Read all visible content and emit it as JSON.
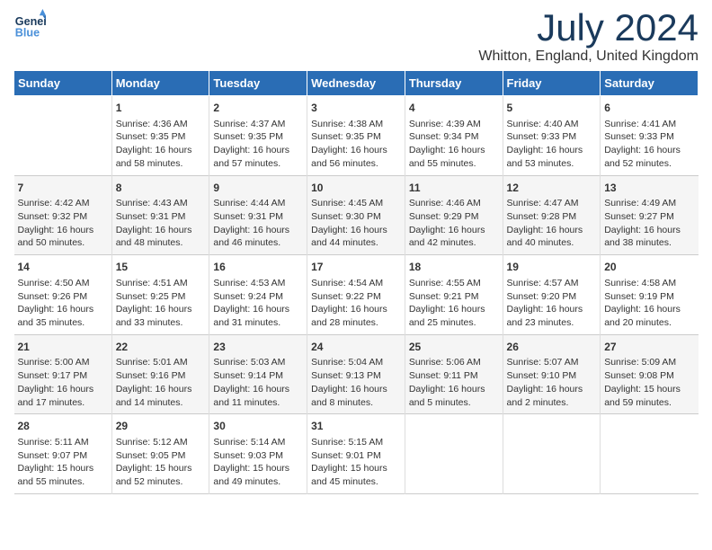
{
  "header": {
    "logo_line1": "General",
    "logo_line2": "Blue",
    "title": "July 2024",
    "subtitle": "Whitton, England, United Kingdom"
  },
  "days_of_week": [
    "Sunday",
    "Monday",
    "Tuesday",
    "Wednesday",
    "Thursday",
    "Friday",
    "Saturday"
  ],
  "weeks": [
    [
      {
        "day": "",
        "info": ""
      },
      {
        "day": "1",
        "info": "Sunrise: 4:36 AM\nSunset: 9:35 PM\nDaylight: 16 hours\nand 58 minutes."
      },
      {
        "day": "2",
        "info": "Sunrise: 4:37 AM\nSunset: 9:35 PM\nDaylight: 16 hours\nand 57 minutes."
      },
      {
        "day": "3",
        "info": "Sunrise: 4:38 AM\nSunset: 9:35 PM\nDaylight: 16 hours\nand 56 minutes."
      },
      {
        "day": "4",
        "info": "Sunrise: 4:39 AM\nSunset: 9:34 PM\nDaylight: 16 hours\nand 55 minutes."
      },
      {
        "day": "5",
        "info": "Sunrise: 4:40 AM\nSunset: 9:33 PM\nDaylight: 16 hours\nand 53 minutes."
      },
      {
        "day": "6",
        "info": "Sunrise: 4:41 AM\nSunset: 9:33 PM\nDaylight: 16 hours\nand 52 minutes."
      }
    ],
    [
      {
        "day": "7",
        "info": "Sunrise: 4:42 AM\nSunset: 9:32 PM\nDaylight: 16 hours\nand 50 minutes."
      },
      {
        "day": "8",
        "info": "Sunrise: 4:43 AM\nSunset: 9:31 PM\nDaylight: 16 hours\nand 48 minutes."
      },
      {
        "day": "9",
        "info": "Sunrise: 4:44 AM\nSunset: 9:31 PM\nDaylight: 16 hours\nand 46 minutes."
      },
      {
        "day": "10",
        "info": "Sunrise: 4:45 AM\nSunset: 9:30 PM\nDaylight: 16 hours\nand 44 minutes."
      },
      {
        "day": "11",
        "info": "Sunrise: 4:46 AM\nSunset: 9:29 PM\nDaylight: 16 hours\nand 42 minutes."
      },
      {
        "day": "12",
        "info": "Sunrise: 4:47 AM\nSunset: 9:28 PM\nDaylight: 16 hours\nand 40 minutes."
      },
      {
        "day": "13",
        "info": "Sunrise: 4:49 AM\nSunset: 9:27 PM\nDaylight: 16 hours\nand 38 minutes."
      }
    ],
    [
      {
        "day": "14",
        "info": "Sunrise: 4:50 AM\nSunset: 9:26 PM\nDaylight: 16 hours\nand 35 minutes."
      },
      {
        "day": "15",
        "info": "Sunrise: 4:51 AM\nSunset: 9:25 PM\nDaylight: 16 hours\nand 33 minutes."
      },
      {
        "day": "16",
        "info": "Sunrise: 4:53 AM\nSunset: 9:24 PM\nDaylight: 16 hours\nand 31 minutes."
      },
      {
        "day": "17",
        "info": "Sunrise: 4:54 AM\nSunset: 9:22 PM\nDaylight: 16 hours\nand 28 minutes."
      },
      {
        "day": "18",
        "info": "Sunrise: 4:55 AM\nSunset: 9:21 PM\nDaylight: 16 hours\nand 25 minutes."
      },
      {
        "day": "19",
        "info": "Sunrise: 4:57 AM\nSunset: 9:20 PM\nDaylight: 16 hours\nand 23 minutes."
      },
      {
        "day": "20",
        "info": "Sunrise: 4:58 AM\nSunset: 9:19 PM\nDaylight: 16 hours\nand 20 minutes."
      }
    ],
    [
      {
        "day": "21",
        "info": "Sunrise: 5:00 AM\nSunset: 9:17 PM\nDaylight: 16 hours\nand 17 minutes."
      },
      {
        "day": "22",
        "info": "Sunrise: 5:01 AM\nSunset: 9:16 PM\nDaylight: 16 hours\nand 14 minutes."
      },
      {
        "day": "23",
        "info": "Sunrise: 5:03 AM\nSunset: 9:14 PM\nDaylight: 16 hours\nand 11 minutes."
      },
      {
        "day": "24",
        "info": "Sunrise: 5:04 AM\nSunset: 9:13 PM\nDaylight: 16 hours\nand 8 minutes."
      },
      {
        "day": "25",
        "info": "Sunrise: 5:06 AM\nSunset: 9:11 PM\nDaylight: 16 hours\nand 5 minutes."
      },
      {
        "day": "26",
        "info": "Sunrise: 5:07 AM\nSunset: 9:10 PM\nDaylight: 16 hours\nand 2 minutes."
      },
      {
        "day": "27",
        "info": "Sunrise: 5:09 AM\nSunset: 9:08 PM\nDaylight: 15 hours\nand 59 minutes."
      }
    ],
    [
      {
        "day": "28",
        "info": "Sunrise: 5:11 AM\nSunset: 9:07 PM\nDaylight: 15 hours\nand 55 minutes."
      },
      {
        "day": "29",
        "info": "Sunrise: 5:12 AM\nSunset: 9:05 PM\nDaylight: 15 hours\nand 52 minutes."
      },
      {
        "day": "30",
        "info": "Sunrise: 5:14 AM\nSunset: 9:03 PM\nDaylight: 15 hours\nand 49 minutes."
      },
      {
        "day": "31",
        "info": "Sunrise: 5:15 AM\nSunset: 9:01 PM\nDaylight: 15 hours\nand 45 minutes."
      },
      {
        "day": "",
        "info": ""
      },
      {
        "day": "",
        "info": ""
      },
      {
        "day": "",
        "info": ""
      }
    ]
  ]
}
